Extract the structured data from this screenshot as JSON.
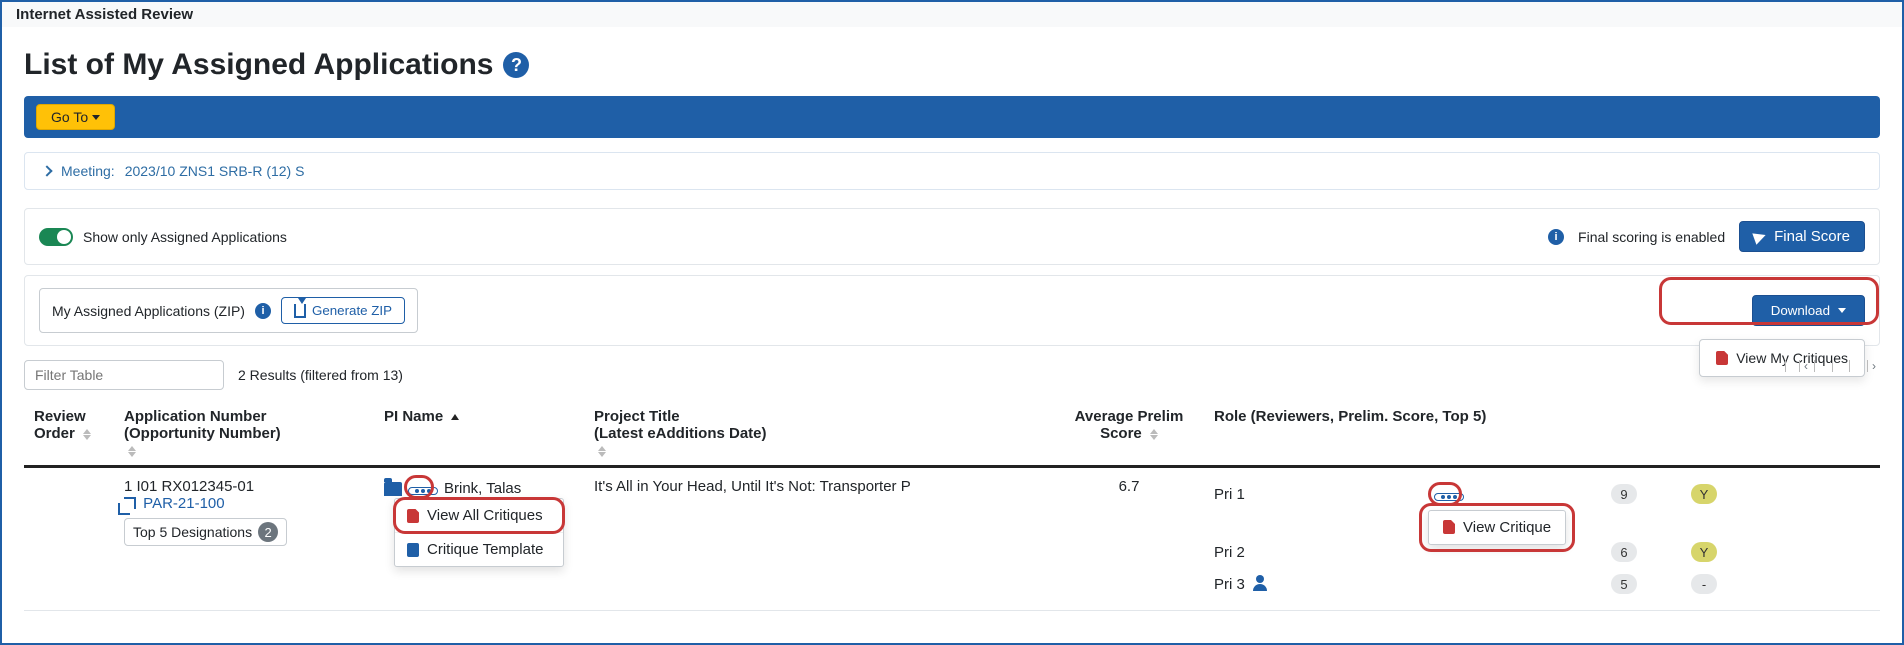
{
  "window_title": "Internet Assisted Review",
  "page_heading": "List of My Assigned Applications",
  "blue_bar": {
    "goto_label": "Go To"
  },
  "meeting": {
    "label": "Meeting:",
    "value": "2023/10 ZNS1 SRB-R (12) S"
  },
  "controls": {
    "toggle_label": "Show only Assigned Applications",
    "status_text": "Final scoring is enabled",
    "final_score_button": "Final Score"
  },
  "zip": {
    "label": "My Assigned Applications (ZIP)",
    "generate_button": "Generate ZIP",
    "download_button": "Download",
    "download_menu_item": "View My Critiques"
  },
  "filter": {
    "placeholder": "Filter Table",
    "results_text": "2 Results (filtered from 13)"
  },
  "columns": {
    "review_order": "Review Order",
    "app_number": "Application Number",
    "opp_number": "(Opportunity Number)",
    "pi_name": "PI Name",
    "project_title": "Project Title",
    "latest_eadd": "(Latest eAdditions Date)",
    "avg_prelim": "Average Prelim Score",
    "role": "Role (Reviewers, Prelim. Score, Top 5)"
  },
  "rows": [
    {
      "app_number": "1 I01 RX012345-01",
      "opportunity": "PAR-21-100",
      "top5_label": "Top 5 Designations",
      "top5_count": "2",
      "pi_name": "Brink, Talas",
      "pi_menu": {
        "view_all": "View All Critiques",
        "template": "Critique Template"
      },
      "project_title": "It's All in Your Head, Until It's Not: Transporter P",
      "avg_score": "6.7",
      "roles": [
        {
          "label": "Pri 1",
          "has_dots": true,
          "menu": "View Critique",
          "score": "9",
          "top5": "Y"
        },
        {
          "label": "Pri 2",
          "has_dots": false,
          "score": "6",
          "top5": "Y"
        },
        {
          "label": "Pri 3",
          "has_user": true,
          "score": "5",
          "top5": "-"
        }
      ]
    }
  ]
}
